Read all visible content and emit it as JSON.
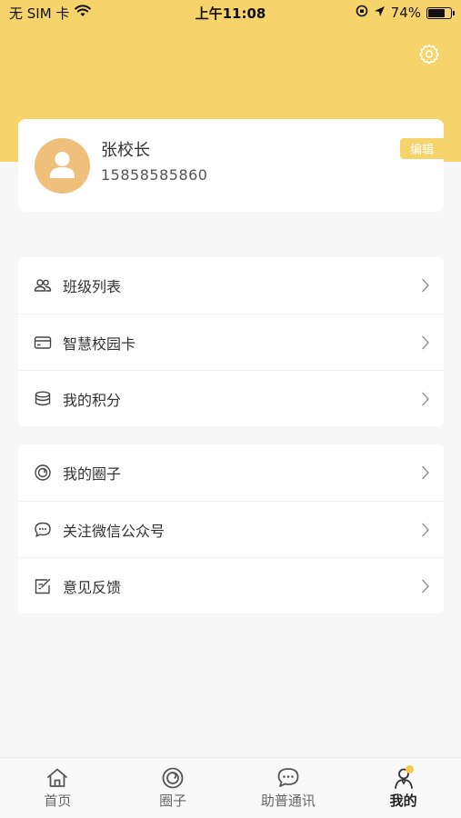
{
  "status_bar": {
    "carrier": "无 SIM 卡",
    "time": "上午11:08",
    "battery_percent": "74%",
    "battery_level": 0.74
  },
  "profile": {
    "name": "张校长",
    "phone": "15858585860",
    "edit_label": "编辑"
  },
  "menu_group_1": [
    {
      "icon": "users-icon",
      "label": "班级列表"
    },
    {
      "icon": "card-icon",
      "label": "智慧校园卡"
    },
    {
      "icon": "coins-icon",
      "label": "我的积分"
    }
  ],
  "menu_group_2": [
    {
      "icon": "circle-spiral-icon",
      "label": "我的圈子"
    },
    {
      "icon": "chat-icon",
      "label": "关注微信公众号"
    },
    {
      "icon": "feedback-icon",
      "label": "意见反馈"
    }
  ],
  "tab_bar": [
    {
      "icon": "home-icon",
      "label": "首页",
      "active": false
    },
    {
      "icon": "circle-spiral-icon",
      "label": "圈子",
      "active": false
    },
    {
      "icon": "chat-icon",
      "label": "助普通讯",
      "active": false
    },
    {
      "icon": "person-icon",
      "label": "我的",
      "active": true
    }
  ],
  "colors": {
    "accent": "#f7d46b",
    "avatar": "#eec07c",
    "background": "#f7f7f7"
  }
}
